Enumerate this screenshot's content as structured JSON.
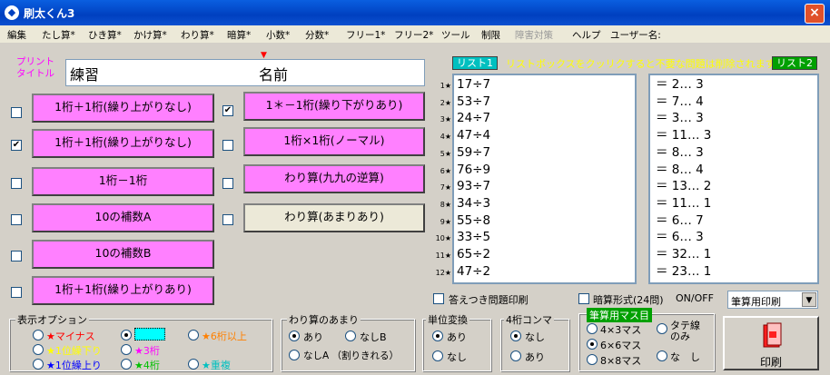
{
  "window": {
    "title": "刷太くん3"
  },
  "menu": [
    "編集",
    "たし算*",
    "ひき算*",
    "かけ算*",
    "わり算*",
    "暗算*",
    "小数*",
    "分数*",
    "フリー1*",
    "フリー2*",
    "ツール",
    "制限",
    "障害対策",
    "ヘルプ",
    "ユーザー名:"
  ],
  "print_title": {
    "label": "プリント\nタイトル",
    "value": "練習",
    "name_label": "名前",
    "marker": "▼"
  },
  "left_buttons": [
    {
      "label": "1桁＋1桁(繰り上がりなし)",
      "checked": false
    },
    {
      "label": "1桁＋1桁(繰り上がりなし)",
      "checked": true
    },
    {
      "label": "1桁－1桁",
      "checked": false
    },
    {
      "label": "10の補数A",
      "checked": false
    },
    {
      "label": "10の補数B",
      "checked": false
    },
    {
      "label": "1桁＋1桁(繰り上がりあり)",
      "checked": false
    }
  ],
  "right_buttons": [
    {
      "label": "1＊－1桁(繰り下がりあり)",
      "checked": true
    },
    {
      "label": "1桁×1桁(ノーマル)",
      "checked": false
    },
    {
      "label": "わり算(九九の逆算)",
      "checked": false
    },
    {
      "label": "わり算(あまりあり)",
      "checked": false
    }
  ],
  "list1": {
    "tab": "リスト1",
    "items": [
      {
        "n": "1★",
        "q": "17÷7"
      },
      {
        "n": "2★",
        "q": "53÷7"
      },
      {
        "n": "3★",
        "q": "24÷7"
      },
      {
        "n": "4★",
        "q": "47÷4"
      },
      {
        "n": "5★",
        "q": "59÷7"
      },
      {
        "n": "6★",
        "q": "76÷9"
      },
      {
        "n": "7★",
        "q": "93÷7"
      },
      {
        "n": "8★",
        "q": "34÷3"
      },
      {
        "n": "9★",
        "q": "55÷8"
      },
      {
        "n": "10★",
        "q": "33÷5"
      },
      {
        "n": "11★",
        "q": "65÷2"
      },
      {
        "n": "12★",
        "q": "47÷2"
      }
    ]
  },
  "hint": "リストボックスをクッリクすると不要な問題は削除されます",
  "list2": {
    "tab": "リスト2",
    "items": [
      "＝ 2… 3",
      "＝ 7… 4",
      "＝ 3… 3",
      "＝ 11… 3",
      "＝ 8… 3",
      "＝ 8… 4",
      "＝ 13… 2",
      "＝ 11… 1",
      "＝ 6… 7",
      "＝ 6… 3",
      "＝ 32… 1",
      "＝ 23… 1"
    ]
  },
  "answer_print": {
    "label": "答えつき問題印刷",
    "checked": false
  },
  "mental_format": {
    "label": "暗算形式(24問)",
    "checked": false,
    "onoff": "ON/OFF"
  },
  "print_select": {
    "value": "筆算用印刷"
  },
  "display_options": {
    "title": "表示オプション",
    "items": [
      {
        "label": "★マイナス",
        "color": "#ff0000",
        "on": false
      },
      {
        "label": "★1位繰下り",
        "color": "#ffff00",
        "on": false
      },
      {
        "label": "★1位繰上り",
        "color": "#0000ff",
        "on": false
      },
      {
        "label": "",
        "color": "#00ffff",
        "on": true
      },
      {
        "label": "★3桁",
        "color": "#ff00ff",
        "on": false
      },
      {
        "label": "★4桁",
        "color": "#00c000",
        "on": false
      },
      {
        "label": "★6桁以上",
        "color": "#ff8000",
        "on": false
      },
      {
        "label": "★重複",
        "color": "#00c0c0",
        "on": false
      }
    ]
  },
  "remainder": {
    "title": "わり算のあまり",
    "opt_ari": "あり",
    "opt_nashiB": "なしB",
    "opt_nashiA": "なしA （割りきれる）"
  },
  "unit": {
    "title": "単位変換",
    "opt_ari": "あり",
    "opt_nashi": "なし"
  },
  "comma": {
    "title": "4桁コンマ",
    "opt_nashi": "なし",
    "opt_ari": "あり"
  },
  "grid": {
    "title": "筆算用マス目",
    "opt_4": "4×3マス",
    "opt_6": "6×6マス",
    "opt_8": "8×8マス",
    "opt_tate": "タテ線\nのみ",
    "opt_nashi": "な　し"
  },
  "print_button": {
    "label": "印刷"
  }
}
